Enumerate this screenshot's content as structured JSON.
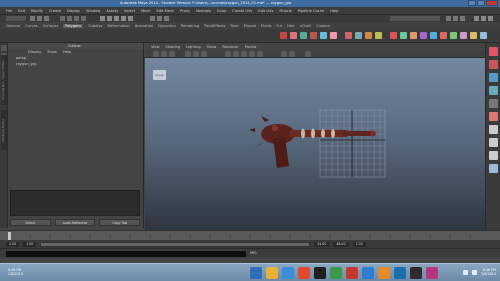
{
  "window": {
    "title": "Autodesk Maya 2014 - Student Version: F:\\Users\\...\\scenes\\raygun_2014_01.mb* --- raygun_grp"
  },
  "menubar": {
    "items": [
      "File",
      "Edit",
      "Modify",
      "Create",
      "Display",
      "Window",
      "Assets",
      "Select",
      "Mesh",
      "Edit Mesh",
      "Proxy",
      "Normals",
      "Color",
      "Create UVs",
      "Edit UVs",
      "Muscle",
      "Pipeline Cache",
      "Help"
    ]
  },
  "shelf": {
    "tabs": [
      "General",
      "Curves",
      "Surfaces",
      "Polygons",
      "Subdivs",
      "Deformation",
      "Animation",
      "Dynamics",
      "Rendering",
      "PaintEffects",
      "Toon",
      "Muscle",
      "Fluids",
      "Fur",
      "Hair",
      "nCloth",
      "Custom"
    ],
    "active_tab": "Polygons"
  },
  "outliner": {
    "header": "Outliner",
    "menu": [
      "Display",
      "Show",
      "Help"
    ],
    "rows": [
      "persp",
      "raygun_grp"
    ]
  },
  "left_side_tabs": [
    "Channel Box / Layer Editor",
    "Attribute Editor"
  ],
  "script_buttons": [
    "Select",
    "Load Attributes",
    "Copy Tab"
  ],
  "viewport": {
    "menu": [
      "View",
      "Shading",
      "Lighting",
      "Show",
      "Renderer",
      "Panels"
    ],
    "camera_tag": "persp"
  },
  "timeline": {
    "start": "1.00",
    "end": "24.00",
    "range_start": "1.00",
    "range_end": "48.00",
    "current": "1.00"
  },
  "mel": {
    "label": "MEL"
  },
  "taskbar": {
    "time": "8:46 PM",
    "date": "2/8/2014"
  },
  "colors": {
    "accent": "#3f6c9e",
    "viewport_top": "#7487a0",
    "viewport_bottom": "#2e3640",
    "model": "#6b2a22"
  }
}
